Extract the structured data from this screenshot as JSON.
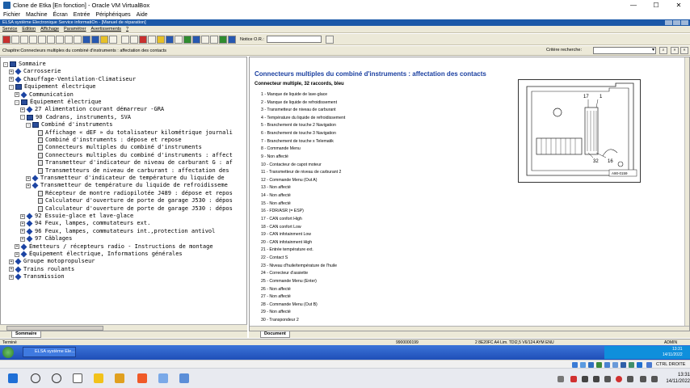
{
  "vbox": {
    "title": "Clone de Etka [En fonction] - Oracle VM VirtualBox",
    "menu": [
      "Fichier",
      "Machine",
      "Écran",
      "Entrée",
      "Périphériques",
      "Aide"
    ],
    "controls": [
      "—",
      "☐",
      "✕"
    ]
  },
  "elsa": {
    "title": "ELSA système Electronique Service informatiOn - [Manuel de réparation]",
    "menu": [
      "Service",
      "Edition",
      "Affichage",
      "Paramètrer",
      "Avertissements",
      "?"
    ],
    "notice_label": "Notice O.R.:",
    "notice_value": "",
    "chapter": "Chapitre:Connecteurs multiples du combiné d'instruments : affectation des contacts",
    "criteria_label": "Critère recherche:",
    "criteria_value": ""
  },
  "tree": {
    "rows": [
      {
        "indent": 0,
        "toggle": "-",
        "icon": "book",
        "label": "Sommaire"
      },
      {
        "indent": 1,
        "toggle": "+",
        "icon": "diamond",
        "label": "Carrosserie"
      },
      {
        "indent": 1,
        "toggle": "+",
        "icon": "diamond",
        "label": "Chauffage-Ventilation-Climatiseur"
      },
      {
        "indent": 1,
        "toggle": "-",
        "icon": "book",
        "label": "Équipement électrique"
      },
      {
        "indent": 2,
        "toggle": "+",
        "icon": "diamond",
        "label": "Communication"
      },
      {
        "indent": 2,
        "toggle": "-",
        "icon": "book",
        "label": "Équipement électrique"
      },
      {
        "indent": 3,
        "toggle": "+",
        "icon": "diamond",
        "label": "27 Alimentation courant démarreur -GRA"
      },
      {
        "indent": 3,
        "toggle": "-",
        "icon": "book",
        "label": "90 Cadrans, instruments, SVA"
      },
      {
        "indent": 4,
        "toggle": "-",
        "icon": "book",
        "label": "Combiné d'instruments"
      },
      {
        "indent": 5,
        "toggle": "",
        "icon": "doc",
        "label": "Affichage « dEF » du totalisateur kilométrique journali"
      },
      {
        "indent": 5,
        "toggle": "",
        "icon": "doc",
        "label": "Combiné d'instruments : dépose et repose"
      },
      {
        "indent": 5,
        "toggle": "",
        "icon": "doc",
        "label": "Connecteurs multiples du combiné d'instruments"
      },
      {
        "indent": 5,
        "toggle": "",
        "icon": "doc",
        "label": "Connecteurs multiples du combiné d'instruments : affect",
        "selected": true
      },
      {
        "indent": 5,
        "toggle": "",
        "icon": "doc",
        "label": "Transmetteur d'indicateur de niveau de carburant G : af"
      },
      {
        "indent": 5,
        "toggle": "",
        "icon": "doc",
        "label": "Transmetteurs de niveau de carburant : affectation des"
      },
      {
        "indent": 4,
        "toggle": "+",
        "icon": "diamond",
        "label": "Transmetteur d'indicateur de température du liquide de"
      },
      {
        "indent": 4,
        "toggle": "+",
        "icon": "diamond",
        "label": "Transmetteur de température du liquide de refroidisseme"
      },
      {
        "indent": 5,
        "toggle": "",
        "icon": "doc",
        "label": "Récepteur de montre radiopilotée J489 : dépose et repos"
      },
      {
        "indent": 5,
        "toggle": "",
        "icon": "doc",
        "label": "Calculateur d'ouverture de porte de garage J530 : dépos"
      },
      {
        "indent": 5,
        "toggle": "",
        "icon": "doc",
        "label": "Calculateur d'ouverture de porte de garage J530 : dépos"
      },
      {
        "indent": 3,
        "toggle": "+",
        "icon": "diamond",
        "label": "92 Essuie-glace et lave-glace"
      },
      {
        "indent": 3,
        "toggle": "+",
        "icon": "diamond",
        "label": "94 Feux, lampes, commutateurs ext."
      },
      {
        "indent": 3,
        "toggle": "+",
        "icon": "diamond",
        "label": "96 Feux, lampes, commutateurs int.,protection antivol"
      },
      {
        "indent": 3,
        "toggle": "+",
        "icon": "diamond",
        "label": "97 Câblages"
      },
      {
        "indent": 2,
        "toggle": "+",
        "icon": "diamond",
        "label": "Émetteurs / récepteurs radio - Instructions de montage"
      },
      {
        "indent": 2,
        "toggle": "+",
        "icon": "diamond",
        "label": "Équipement électrique, Informations générales"
      },
      {
        "indent": 1,
        "toggle": "+",
        "icon": "diamond",
        "label": "Groupe motopropulseur"
      },
      {
        "indent": 1,
        "toggle": "+",
        "icon": "diamond",
        "label": "Trains roulants"
      },
      {
        "indent": 1,
        "toggle": "+",
        "icon": "diamond",
        "label": "Transmission"
      }
    ],
    "tab_label": "Sommaire"
  },
  "document": {
    "title": "Connecteurs multiples du combiné d'instruments : affectation des contacts",
    "subtitle": "Connecteur multiple, 32 raccords, bleu",
    "pins": [
      "1 - Manque de liquide de lave-glace",
      "2 - Manque de liquide de refroidissement",
      "3 - Transmetteur de niveau de carburant",
      "4 - Température du liquide de refroidissement",
      "5 - Branchement de touche 2 Navigation",
      "6 - Branchement de touche 3 Navigation",
      "7 - Branchement de touche x Telematik",
      "8 - Commande Menu",
      "9 - Non affecté",
      "10 - Contacteur de capot moteur",
      "11 - Transmetteur de niveau de carburant 2",
      "12 - Commande Menu (Out A)",
      "13 - Non affecté",
      "14 - Non affecté",
      "15 - Non affecté",
      "16 - FDR/ASR (= ESP)",
      "17 - CAN confort High",
      "18 - CAN confort Low",
      "19 - CAN infotainment Low",
      "20 - CAN infotainment High",
      "21 - Entrée température ext.",
      "22 - Contact S",
      "23 - Niveau d'huile/température de l'huile",
      "24 - Correcteur d'assiette",
      "25 - Commande Menu (Enter)",
      "26 - Non affecté",
      "27 - Non affecté",
      "28 - Commande Menu (Out B)",
      "29 - Non affecté",
      "30 - Transpondeur 2",
      "31 - Transpondeur 1",
      "32 - Borne 31 (capteur)"
    ],
    "diagram_labels": {
      "l17": "17",
      "l1": "1",
      "l32": "32",
      "l16": "16",
      "code": "A90-0159"
    },
    "tab_label": "Document"
  },
  "status": {
    "left": "Terminé",
    "code": "9900000199",
    "info": "2   8E20FC   A4 Lim. TDI2,5 V6/124   AYM   ENU",
    "user": "ADMIN"
  },
  "guest_taskbar": {
    "task_label": "ELSA système Ele...",
    "time": "13:31",
    "date": "14/11/2022"
  },
  "vbox_status": {
    "host_key": "CTRL DROITE"
  },
  "host_taskbar": {
    "time": "13:31",
    "date": "14/11/2022"
  }
}
